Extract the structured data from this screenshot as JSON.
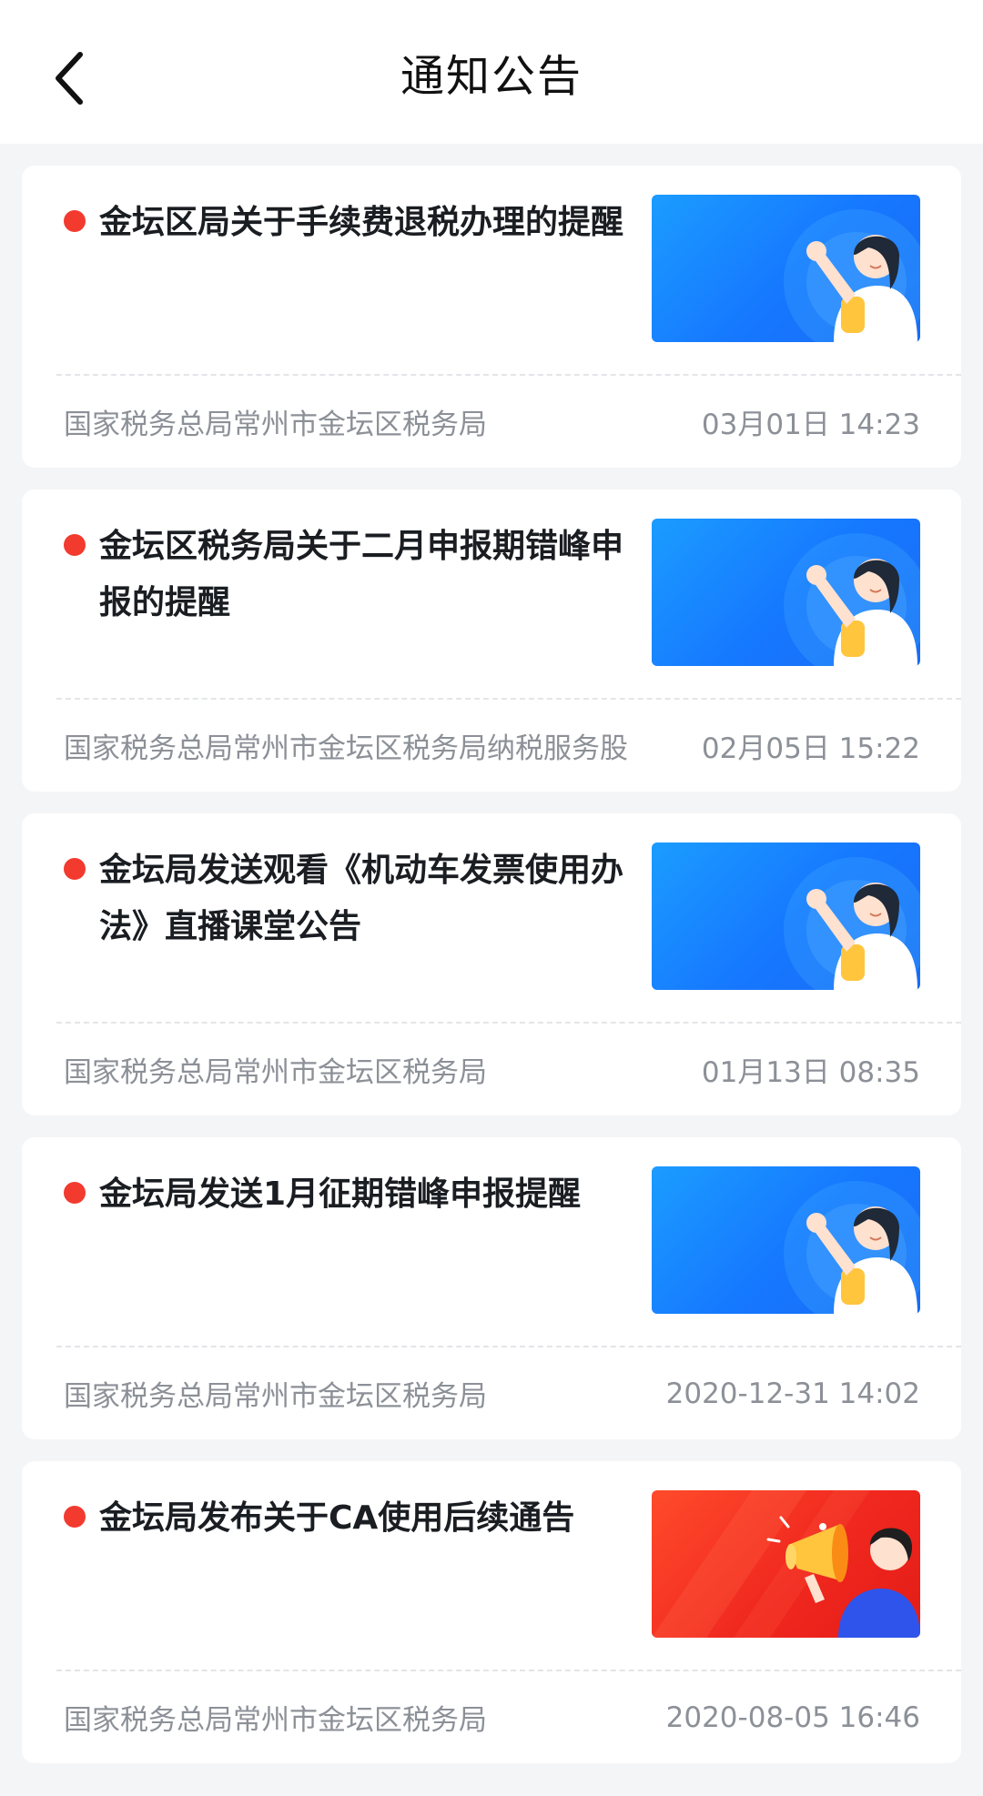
{
  "header": {
    "title": "通知公告"
  },
  "notices": [
    {
      "title": "金坛区局关于手续费退税办理的提醒",
      "source": "国家税务总局常州市金坛区税务局",
      "time": "03月01日 14:23",
      "thumbnail": "announcement-woman-waving",
      "thumbnail_color": "#1677ff"
    },
    {
      "title": "金坛区税务局关于二月申报期错峰申报的提醒",
      "source": "国家税务总局常州市金坛区税务局纳税服务股",
      "time": "02月05日 15:22",
      "thumbnail": "announcement-woman-waving",
      "thumbnail_color": "#1677ff"
    },
    {
      "title": "金坛局发送观看《机动车发票使用办法》直播课堂公告",
      "source": "国家税务总局常州市金坛区税务局",
      "time": "01月13日 08:35",
      "thumbnail": "announcement-woman-waving",
      "thumbnail_color": "#1677ff"
    },
    {
      "title": "金坛局发送1月征期错峰申报提醒",
      "source": "国家税务总局常州市金坛区税务局",
      "time": "2020-12-31 14:02",
      "thumbnail": "announcement-woman-waving",
      "thumbnail_color": "#1677ff"
    },
    {
      "title": "金坛局发布关于CA使用后续通告",
      "source": "国家税务总局常州市金坛区税务局",
      "time": "2020-08-05 16:46",
      "thumbnail": "announcement-megaphone",
      "thumbnail_color": "#f0281f"
    }
  ],
  "colors": {
    "unread_dot": "#f23a2f",
    "meta_text": "#8c9097",
    "background": "#f4f5f7"
  }
}
